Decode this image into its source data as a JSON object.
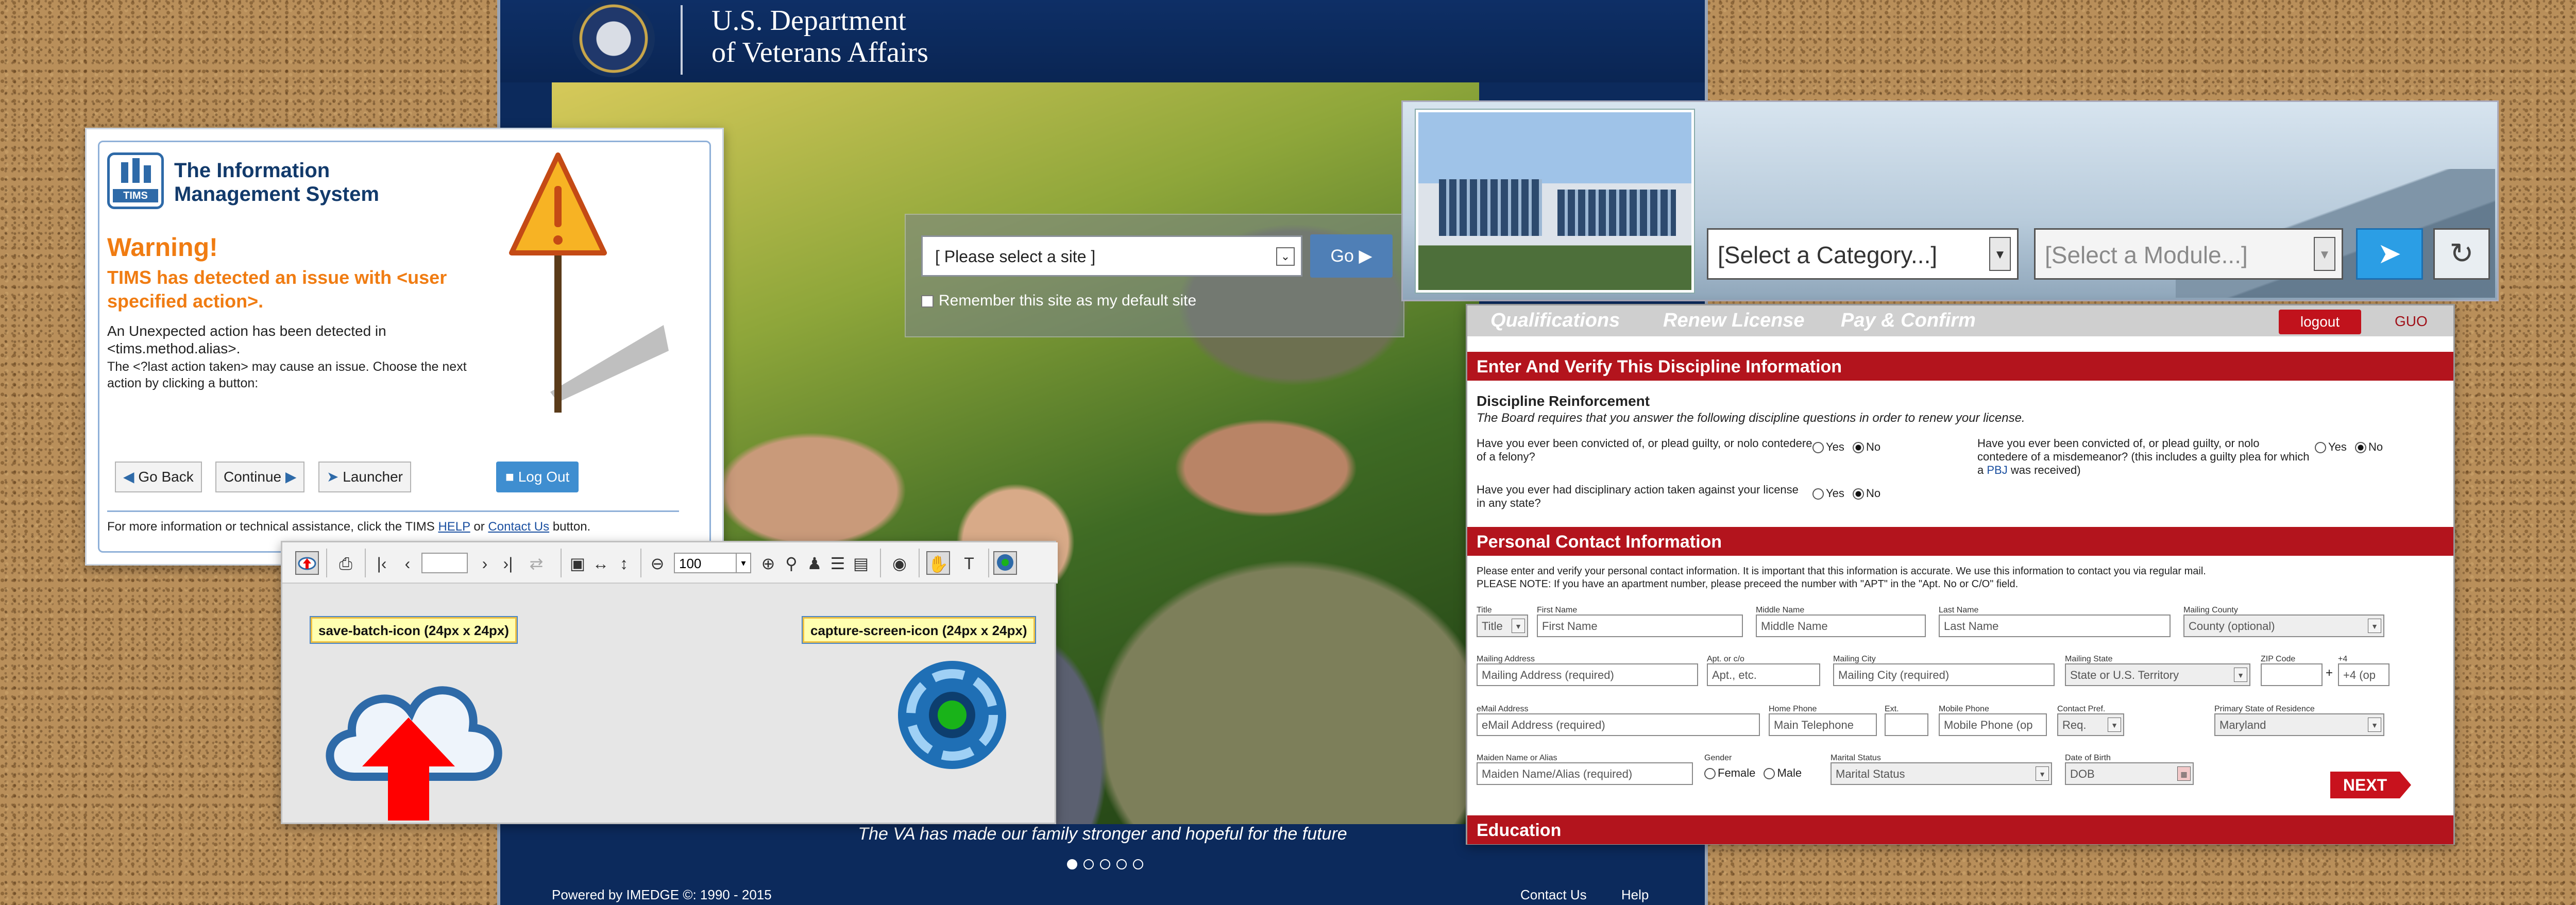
{
  "va": {
    "title_line1": "U.S. Department",
    "title_line2": "of Veterans Affairs",
    "site_select": "[ Please select a site ]",
    "go_label": "Go",
    "remember_label": "Remember this site as my default site",
    "caption": "The VA has made our family stronger and hopeful for the future",
    "footer_powered": "Powered by IMEDGE ©: 1990 - 2015",
    "footer_contact": "Contact Us",
    "footer_help": "Help"
  },
  "tims": {
    "logo_text": "TIMS",
    "brand_line1": "The Information",
    "brand_line2": "Management System",
    "warning": "Warning!",
    "detected": "TIMS has detected an issue with <user specified action>.",
    "message1": "An Unexpected action has been detected in <tims.method.alias>.",
    "message2": "The <?last action taken> may cause an issue. Choose the next action by clicking a button:",
    "buttons": {
      "go_back": "Go Back",
      "continue": "Continue",
      "launcher": "Launcher",
      "log_out": "Log Out"
    },
    "footer_pre": "For more information or technical assistance, click the TIMS",
    "footer_help": "HELP",
    "footer_or": "or",
    "footer_contact": "Contact Us",
    "footer_post": "button."
  },
  "toolbar": {
    "zoom_value": "100",
    "tooltip_save": "save-batch-icon (24px x 24px)",
    "tooltip_capture": "capture-screen-icon (24px x 24px)"
  },
  "category_bar": {
    "category_select": "[Select a Category...]",
    "module_select": "[Select a Module...]"
  },
  "license": {
    "steps": [
      "Qualifications",
      "Renew License",
      "Pay & Confirm"
    ],
    "logout": "logout",
    "user": "GUO",
    "section_discipline": "Enter And Verify This Discipline Information",
    "discipline_heading": "Discipline Reinforcement",
    "discipline_intro": "The Board requires that you answer the following discipline questions in order to renew your license.",
    "q_felony": "Have you ever been convicted of, or plead guilty, or nolo contedere of a felony?",
    "q_misdemeanor_a": "Have you ever been convicted of, or plead guilty, or nolo contedere of a misdemeanor? (this includes a guilty plea for which a",
    "q_misdemeanor_pbj": "PBJ",
    "q_misdemeanor_b": "was received)",
    "q_disciplinary": "Have you ever had disciplinary action taken against your license in any state?",
    "yes": "Yes",
    "no": "No",
    "section_contact": "Personal Contact Information",
    "contact_intro": "Please enter and verify your personal contact information. It is important that this information is accurate. We use this information to contact you via regular mail.",
    "contact_note": "PLEASE NOTE: If you have an apartment number, please preceed the number with \"APT\" in the \"Apt. No or C/O\" field.",
    "labels": {
      "title": "Title",
      "first": "First Name",
      "middle": "Middle Name",
      "last": "Last Name",
      "county": "Mailing County",
      "address": "Mailing Address",
      "apt": "Apt. or c/o",
      "city": "Mailing City",
      "state": "Mailing State",
      "zip": "ZIP Code",
      "plus4": "+4",
      "email": "eMail Address",
      "home": "Home Phone",
      "ext": "Ext.",
      "mobile": "Mobile Phone",
      "contact_pref": "Contact Pref.",
      "residence": "Primary State of Residence",
      "maiden": "Maiden Name or Alias",
      "gender": "Gender",
      "marital": "Marital Status",
      "dob": "Date of Birth"
    },
    "values": {
      "title": "Title",
      "first": "First Name",
      "middle": "Middle Name",
      "last": "Last Name",
      "county": "County (optional)",
      "address": "Mailing Address (required)",
      "apt": "Apt., etc.",
      "city": "Mailing City (required)",
      "state": "State or U.S. Territory",
      "zip": "",
      "plus4": "+4 (op",
      "email": "eMail Address (required)",
      "home": "Main Telephone",
      "ext": "",
      "mobile": "Mobile Phone (op",
      "contact_pref": "Req.",
      "residence": "Maryland",
      "maiden": "Maiden Name/Alias (required)",
      "female": "Female",
      "male": "Male",
      "marital": "Marital Status",
      "dob": "DOB"
    },
    "plus_sign": "+",
    "next": "NEXT",
    "section_education": "Education"
  }
}
